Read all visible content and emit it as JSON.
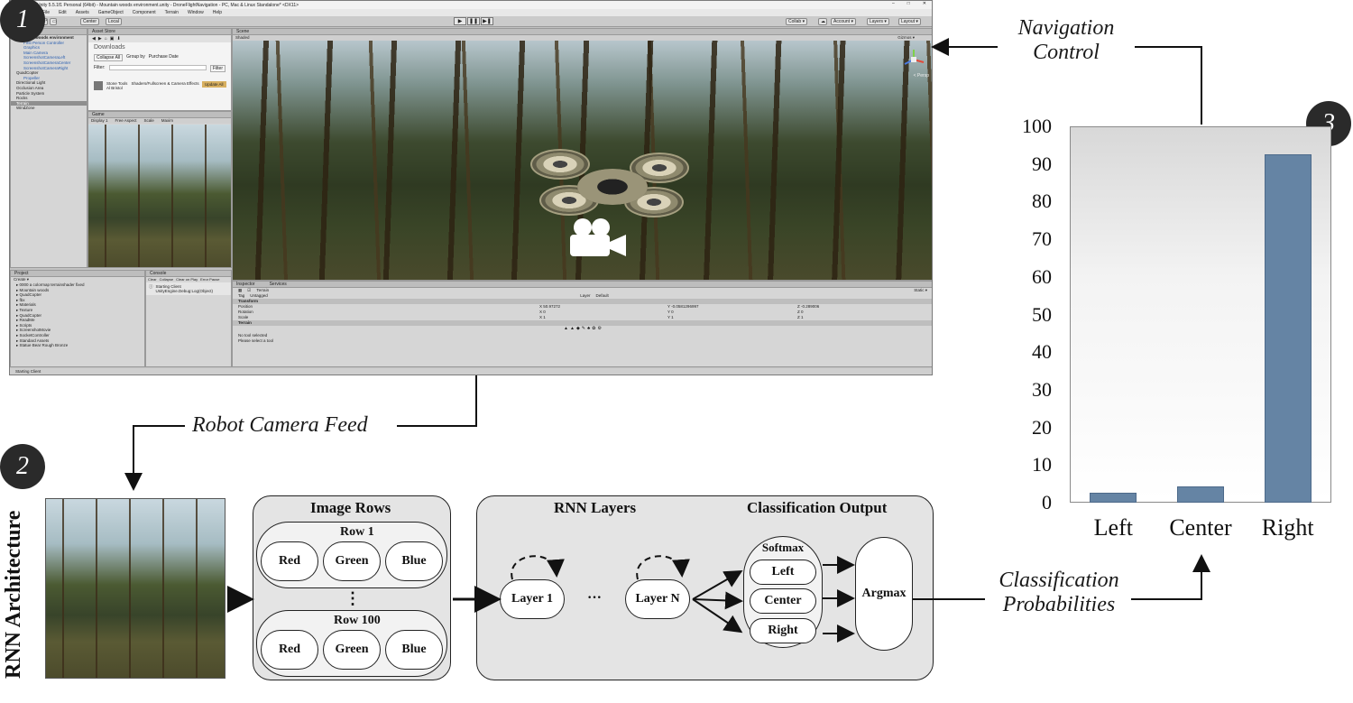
{
  "badges": {
    "one": "1",
    "two": "2",
    "three": "3"
  },
  "unity": {
    "title": "Unity 5.5.1f1 Personal (64bit) - Mountain woods environment.unity - DroneFlightNavigation - PC, Mac & Linux Standalone* <DX11>",
    "menu": [
      "File",
      "Edit",
      "Assets",
      "GameObject",
      "Component",
      "Terrain",
      "Window",
      "Help"
    ],
    "toolbar": {
      "center": "Center",
      "local": "Local",
      "collab": "Collab ▾",
      "account": "Account ▾",
      "layers": "Layers ▾",
      "layout": "Layout ▾"
    },
    "hierarchy": {
      "tab": "Hierarchy",
      "items": [
        {
          "label": "Mountain woods environment",
          "kind": "bold"
        },
        {
          "label": "First Person Controller",
          "kind": "child"
        },
        {
          "label": "Graphics",
          "kind": "child"
        },
        {
          "label": "Main Camera",
          "kind": "child"
        },
        {
          "label": "ScreenshotCameraLeft",
          "kind": "child"
        },
        {
          "label": "ScreenshotCameraCenter",
          "kind": "child"
        },
        {
          "label": "ScreenshotCameraRight",
          "kind": "child"
        },
        {
          "label": "QuadCopter",
          "kind": ""
        },
        {
          "label": "Propeller",
          "kind": "child"
        },
        {
          "label": "Directional Light",
          "kind": ""
        },
        {
          "label": "Occlusion Area",
          "kind": ""
        },
        {
          "label": "Particle System",
          "kind": ""
        },
        {
          "label": "Rocks",
          "kind": ""
        },
        {
          "label": "Terrain",
          "kind": "sel"
        },
        {
          "label": "WindZone",
          "kind": ""
        }
      ]
    },
    "asset_store": {
      "tab": "Asset Store",
      "header": "Downloads",
      "collapse": "Collapse All",
      "group_by": "Group by",
      "purchase_date": "Purchase Date",
      "filter_label": "Filter:",
      "filter_btn": "Filter",
      "asset_name": "Stone Tools",
      "asset_author": "Al Bristol",
      "asset_cat": "Shaders/Fullscreen & Camera Effects",
      "update_btn": "Update All"
    },
    "game": {
      "tab": "Game",
      "display": "Display 1",
      "aspect": "Free Aspect",
      "scale": "Scale",
      "maximize": "Maxim"
    },
    "scene": {
      "tab": "Scene",
      "shading": "Shaded",
      "gizmos": "Gizmos ▾",
      "persp": "< Persp"
    },
    "project": {
      "tab": "Project",
      "create": "Create ▾",
      "items": [
        "0000 a colormap terrainshader fixed",
        "Mountain woods",
        "QuadCopter",
        "fbx",
        "Materials",
        "Texture",
        "QuadCopter",
        "ReadMe",
        "Scripts",
        "ScreenshotMovie",
        "SocketController",
        "Standard Assets",
        "Statue Bear Rough Bronze"
      ]
    },
    "console": {
      "tab": "Console",
      "clear": "Clear",
      "collapse": "Collapse",
      "clear_on_play": "Clear on Play",
      "error_pause": "Error Pause",
      "log1": "Starting Client",
      "log2": "UnityEngine.Debug:Log(Object)"
    },
    "inspector": {
      "tab": "Inspector",
      "services": "Services",
      "object": "Terrain",
      "static": "Static ▾",
      "tag": "Tag",
      "tag_value": "Untagged",
      "layer": "Layer",
      "layer_value": "Default",
      "transform": "Transform",
      "position": "Position",
      "pos_x": "X 50.97272",
      "pos_y": "Y -0.0581296997",
      "pos_z": "Z -0.289006",
      "rotation": "Rotation",
      "rot_x": "X 0",
      "rot_y": "Y 0",
      "rot_z": "Z 0",
      "scale": "Scale",
      "sc_x": "X 1",
      "sc_y": "Y 1",
      "sc_z": "Z 1",
      "terrain": "Terrain",
      "no_tool": "No tool selected",
      "select_tool": "Please select a tool"
    },
    "status": "Starting Client"
  },
  "annotations": {
    "navigation_control": [
      "Navigation",
      "Control"
    ],
    "robot_camera_feed": "Robot Camera Feed",
    "classification_probabilities": [
      "Classification",
      "Probabilities"
    ]
  },
  "chart_data": {
    "type": "bar",
    "categories": [
      "Left",
      "Center",
      "Right"
    ],
    "values": [
      2.6,
      4.3,
      92.5
    ],
    "ylim": [
      0,
      100
    ],
    "yticks": [
      0,
      10,
      20,
      30,
      40,
      50,
      60,
      70,
      80,
      90,
      100
    ],
    "grid": false,
    "bar_color": "#6584a4"
  },
  "rnn": {
    "title": "RNN Architecture",
    "image_rows": {
      "title": "Image Rows",
      "row1": "Row 1",
      "row100": "Row 100",
      "ellipsis": "⋮",
      "channels": [
        "Red",
        "Green",
        "Blue"
      ]
    },
    "rnn_layers": {
      "title": "RNN Layers",
      "layer1": "Layer 1",
      "layerN": "Layer N",
      "dots": "···"
    },
    "classification": {
      "title": "Classification Output",
      "softmax": "Softmax",
      "outputs": [
        "Left",
        "Center",
        "Right"
      ],
      "argmax": "Argmax"
    }
  }
}
